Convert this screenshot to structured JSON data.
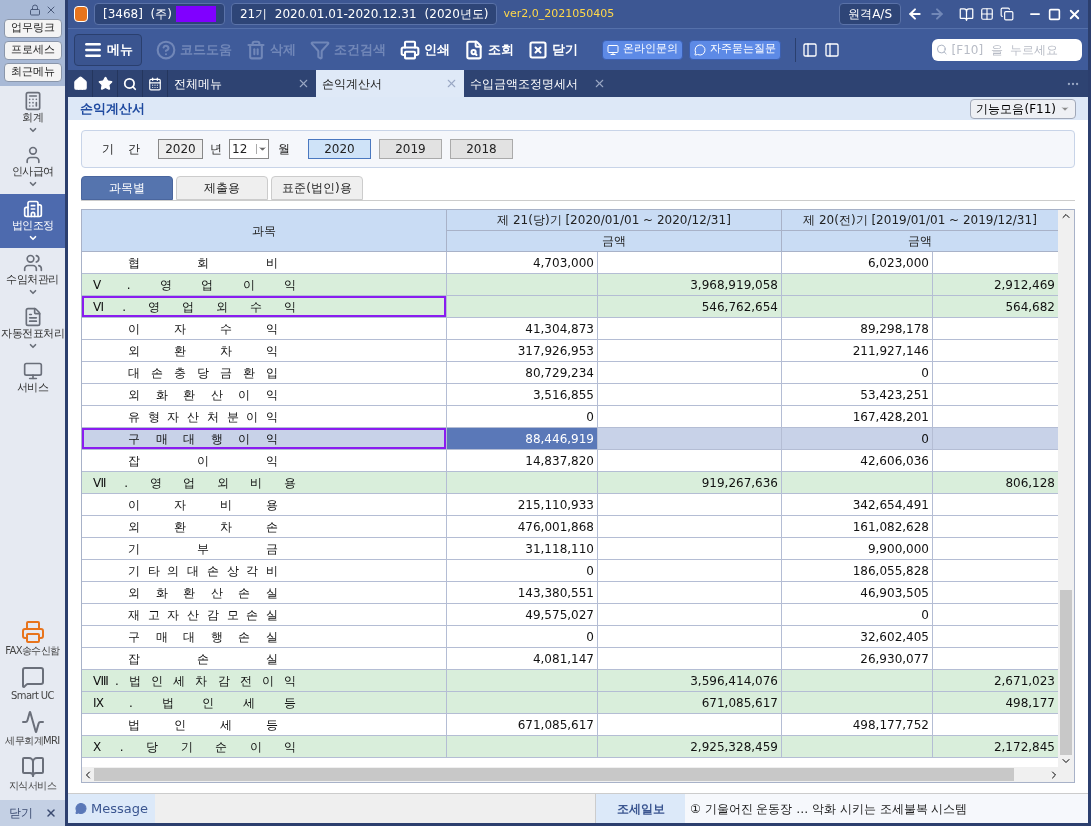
{
  "sidebar": {
    "top_buttons": [
      "업무링크",
      "프로세스",
      "최근메뉴"
    ],
    "modules": [
      {
        "label": "회계",
        "selected": false,
        "expandable": true
      },
      {
        "label": "인사급여",
        "selected": false,
        "expandable": true
      },
      {
        "label": "법인조정",
        "selected": true,
        "expandable": true
      },
      {
        "label": "수임처관리",
        "selected": false,
        "expandable": true
      },
      {
        "label": "자동전표처리",
        "selected": false,
        "expandable": true
      },
      {
        "label": "서비스",
        "selected": false,
        "expandable": false
      }
    ],
    "tools": [
      "FAX송수신함",
      "Smart UC",
      "세무회계MRI",
      "지식서비스"
    ],
    "close": "닫기"
  },
  "header": {
    "company_code": "[3468]  (주)",
    "period": "21기  2020.01.01-2020.12.31",
    "fiscal_year": "(2020년도)",
    "version": "ver2,0_2021050405",
    "remote_button": "원격A/S"
  },
  "toolbar": {
    "menu": "메뉴",
    "items": [
      {
        "label": "코드도움",
        "disabled": true
      },
      {
        "label": "삭제",
        "disabled": true
      },
      {
        "label": "조건검색",
        "disabled": true
      },
      {
        "label": "인쇄",
        "disabled": false
      },
      {
        "label": "조회",
        "disabled": false
      },
      {
        "label": "닫기",
        "disabled": false
      }
    ],
    "help_buttons": [
      "온라인문의",
      "자주묻는질문"
    ],
    "search": {
      "placeholder": "[F10]  을  누르세요"
    }
  },
  "tabs": [
    {
      "label": "전체메뉴",
      "selected": false
    },
    {
      "label": "손익계산서",
      "selected": true
    },
    {
      "label": "수입금액조정명세서",
      "selected": false
    }
  ],
  "page": {
    "title": "손익계산서",
    "function_menu": "기능모음(F11)"
  },
  "period": {
    "label": "기 간",
    "year": "2020",
    "year_unit": "년",
    "month": "12",
    "month_unit": "월",
    "year_buttons": [
      {
        "label": "2020",
        "selected": true
      },
      {
        "label": "2019",
        "selected": false
      },
      {
        "label": "2018",
        "selected": false
      }
    ]
  },
  "view_tabs": [
    {
      "label": "과목별",
      "selected": true
    },
    {
      "label": "제출용",
      "selected": false
    },
    {
      "label": "표준(법인)용",
      "selected": false
    }
  ],
  "table": {
    "account_header": "과목",
    "periods": [
      {
        "title": "제 21(당)기 [2020/01/01 ~ 2020/12/31]",
        "subheader": "금액"
      },
      {
        "title": "제 20(전)기 [2019/01/01 ~ 2019/12/31]",
        "subheader": "금액"
      }
    ],
    "rows": [
      {
        "kind": "item",
        "label": "협 회 비",
        "cur_detail": "4,703,000",
        "prev_detail": "6,023,000",
        "selected": false,
        "outlined": false
      },
      {
        "kind": "section",
        "label": "Ⅴ. 영 업 이 익",
        "cur_total": "3,968,919,058",
        "prev_total": "2,912,469",
        "selected": false,
        "outlined": false
      },
      {
        "kind": "section",
        "label": "Ⅵ. 영 업 외 수 익",
        "cur_total": "546,762,654",
        "prev_total": "564,682",
        "selected": false,
        "outlined": true
      },
      {
        "kind": "item",
        "label": "이 자 수 익",
        "cur_detail": "41,304,873",
        "prev_detail": "89,298,178",
        "selected": false,
        "outlined": false
      },
      {
        "kind": "item",
        "label": "외 환 차 익",
        "cur_detail": "317,926,953",
        "prev_detail": "211,927,146",
        "selected": false,
        "outlined": false
      },
      {
        "kind": "item",
        "label": "대 손 충 당 금 환 입",
        "cur_detail": "80,729,234",
        "prev_detail": "0",
        "selected": false,
        "outlined": false
      },
      {
        "kind": "item",
        "label": "외 화 환 산 이 익",
        "cur_detail": "3,516,855",
        "prev_detail": "53,423,251",
        "selected": false,
        "outlined": false
      },
      {
        "kind": "item",
        "label": "유 형 자 산 처 분 이 익",
        "cur_detail": "0",
        "prev_detail": "167,428,201",
        "selected": false,
        "outlined": false
      },
      {
        "kind": "item",
        "label": "구 매 대 행 이 익",
        "cur_detail": "88,446,919",
        "prev_detail": "0",
        "selected": true,
        "outlined": true
      },
      {
        "kind": "item",
        "label": "잡 이 익",
        "cur_detail": "14,837,820",
        "prev_detail": "42,606,036",
        "selected": false,
        "outlined": false
      },
      {
        "kind": "section",
        "label": "Ⅶ. 영 업 외 비 용",
        "cur_total": "919,267,636",
        "prev_total": "806,128",
        "selected": false,
        "outlined": false
      },
      {
        "kind": "item",
        "label": "이 자 비 용",
        "cur_detail": "215,110,933",
        "prev_detail": "342,654,491",
        "selected": false,
        "outlined": false
      },
      {
        "kind": "item",
        "label": "외 환 차 손",
        "cur_detail": "476,001,868",
        "prev_detail": "161,082,628",
        "selected": false,
        "outlined": false
      },
      {
        "kind": "item",
        "label": "기 부 금",
        "cur_detail": "31,118,110",
        "prev_detail": "9,900,000",
        "selected": false,
        "outlined": false
      },
      {
        "kind": "item",
        "label": "기 타 의 대 손 상 각 비",
        "cur_detail": "0",
        "prev_detail": "186,055,828",
        "selected": false,
        "outlined": false
      },
      {
        "kind": "item",
        "label": "외 화 환 산 손 실",
        "cur_detail": "143,380,551",
        "prev_detail": "46,903,505",
        "selected": false,
        "outlined": false
      },
      {
        "kind": "item",
        "label": "재 고 자 산 감 모 손 실",
        "cur_detail": "49,575,027",
        "prev_detail": "0",
        "selected": false,
        "outlined": false
      },
      {
        "kind": "item",
        "label": "구 매 대 행 손 실",
        "cur_detail": "0",
        "prev_detail": "32,602,405",
        "selected": false,
        "outlined": false
      },
      {
        "kind": "item",
        "label": "잡 손 실",
        "cur_detail": "4,081,147",
        "prev_detail": "26,930,077",
        "selected": false,
        "outlined": false
      },
      {
        "kind": "section",
        "label": "Ⅷ. 법 인 세 차 감 전 이 익",
        "cur_total": "3,596,414,076",
        "prev_total": "2,671,023",
        "selected": false,
        "outlined": false
      },
      {
        "kind": "section",
        "label": "Ⅸ. 법 인 세 등",
        "cur_total": "671,085,617",
        "prev_total": "498,177",
        "selected": false,
        "outlined": false
      },
      {
        "kind": "item",
        "label": "법 인 세 등",
        "cur_detail": "671,085,617",
        "prev_detail": "498,177,752",
        "selected": false,
        "outlined": false
      },
      {
        "kind": "section",
        "label": "Ⅹ. 당 기 순 이 익",
        "cur_total": "2,925,328,459",
        "prev_total": "2,172,845",
        "selected": false,
        "outlined": false
      }
    ]
  },
  "status_bar": {
    "message": "Message",
    "news_source": "조세일보",
    "headline": "① 기울어진 운동장 … 악화 시키는 조세불복 시스템"
  }
}
